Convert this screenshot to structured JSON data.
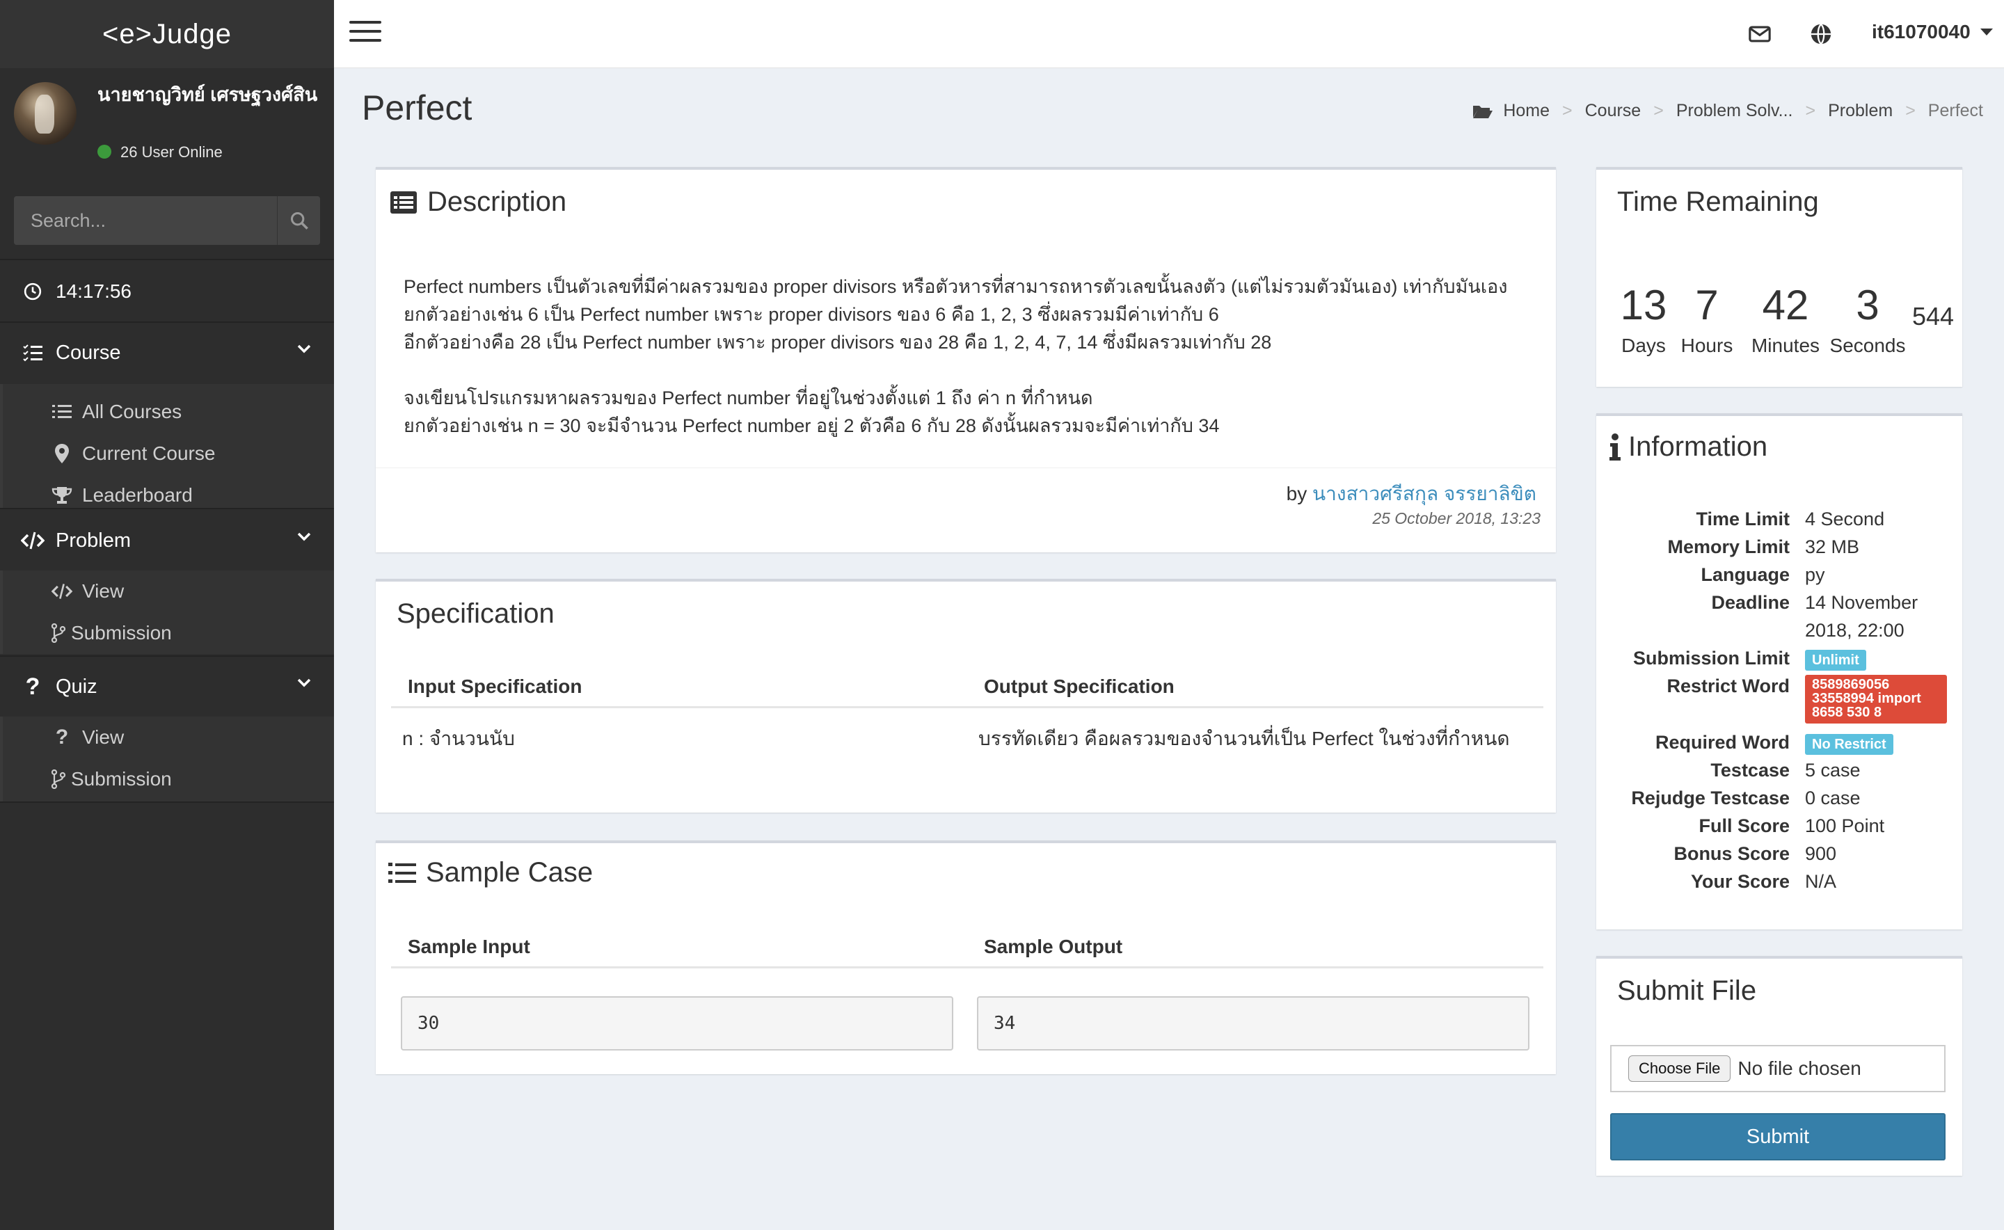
{
  "brand": "<e>Judge",
  "user": {
    "name": "นายชาญวิทย์ เศรษฐวงศ์สิน",
    "online": "26 User Online"
  },
  "search": {
    "placeholder": "Search..."
  },
  "clock": "14:17:56",
  "menu": {
    "course": {
      "label": "Course",
      "items": [
        "All Courses",
        "Current Course",
        "Leaderboard"
      ]
    },
    "problem": {
      "label": "Problem",
      "items": [
        "View",
        "Submission"
      ]
    },
    "quiz": {
      "label": "Quiz",
      "items": [
        "View",
        "Submission"
      ]
    }
  },
  "topbar": {
    "username": "it61070040"
  },
  "page": {
    "title": "Perfect",
    "breadcrumb": [
      "Home",
      "Course",
      "Problem Solv...",
      "Problem",
      "Perfect"
    ]
  },
  "description": {
    "title": "Description",
    "lines": [
      "Perfect numbers เป็นตัวเลขที่มีค่าผลรวมของ proper divisors หรือตัวหารที่สามารถหารตัวเลขนั้นลงตัว (แต่ไม่รวมตัวมันเอง) เท่ากับมันเอง",
      "ยกตัวอย่างเช่น 6 เป็น Perfect number เพราะ proper divisors ของ 6 คือ 1, 2, 3 ซึ่งผลรวมมีค่าเท่ากับ 6",
      "อีกตัวอย่างคือ 28 เป็น Perfect number เพราะ proper divisors ของ 28 คือ 1, 2, 4, 7, 14 ซึ่งมีผลรวมเท่ากับ 28",
      "",
      "จงเขียนโปรแกรมหาผลรวมของ Perfect number ที่อยู่ในช่วงตั้งแต่ 1 ถึง ค่า n ที่กำหนด",
      "ยกตัวอย่างเช่น n = 30 จะมีจำนวน Perfect number อยู่ 2 ตัวคือ 6 กับ 28 ดังนั้นผลรวมจะมีค่าเท่ากับ 34"
    ],
    "by": "by",
    "author": "นางสาวศรีสกุล จรรยาลิขิต",
    "date": "25 October 2018, 13:23"
  },
  "specification": {
    "title": "Specification",
    "input_header": "Input Specification",
    "output_header": "Output Specification",
    "input": "n : จำนวนนับ",
    "output": "บรรทัดเดียว คือผลรวมของจำนวนที่เป็น Perfect ในช่วงที่กำหนด"
  },
  "sample": {
    "title": "Sample Case",
    "input_header": "Sample Input",
    "output_header": "Sample Output",
    "input": "30",
    "output": "34"
  },
  "time_remaining": {
    "title": "Time Remaining",
    "days": "13",
    "hours": "7",
    "minutes": "42",
    "seconds": "3",
    "ms": "544",
    "days_label": "Days",
    "hours_label": "Hours",
    "minutes_label": "Minutes",
    "seconds_label": "Seconds"
  },
  "information": {
    "title": "Information",
    "rows": {
      "time_limit": {
        "k": "Time Limit",
        "v": "4 Second"
      },
      "memory_limit": {
        "k": "Memory Limit",
        "v": "32 MB"
      },
      "language": {
        "k": "Language",
        "v": "py"
      },
      "deadline": {
        "k": "Deadline",
        "v": "14 November 2018, 22:00"
      },
      "submission_limit": {
        "k": "Submission Limit",
        "v": "Unlimit"
      },
      "restrict_word": {
        "k": "Restrict Word",
        "v": "8589869056 33558994 import 8658 530 8"
      },
      "required_word": {
        "k": "Required Word",
        "v": "No Restrict"
      },
      "testcase": {
        "k": "Testcase",
        "v": "5 case"
      },
      "rejudge": {
        "k": "Rejudge Testcase",
        "v": "0 case"
      },
      "full_score": {
        "k": "Full Score",
        "v": "100 Point"
      },
      "bonus_score": {
        "k": "Bonus Score",
        "v": "900"
      },
      "your_score": {
        "k": "Your Score",
        "v": "N/A"
      }
    }
  },
  "submit_file": {
    "title": "Submit File",
    "choose": "Choose File",
    "no_file": "No file chosen",
    "submit": "Submit"
  },
  "colors": {
    "sidebar": "#2d2d2d",
    "accent": "#3c8dbc",
    "submit": "#367fa9",
    "badge_blue": "#5bc0de",
    "badge_red": "#dd4b39",
    "online": "#3c9a3c"
  }
}
